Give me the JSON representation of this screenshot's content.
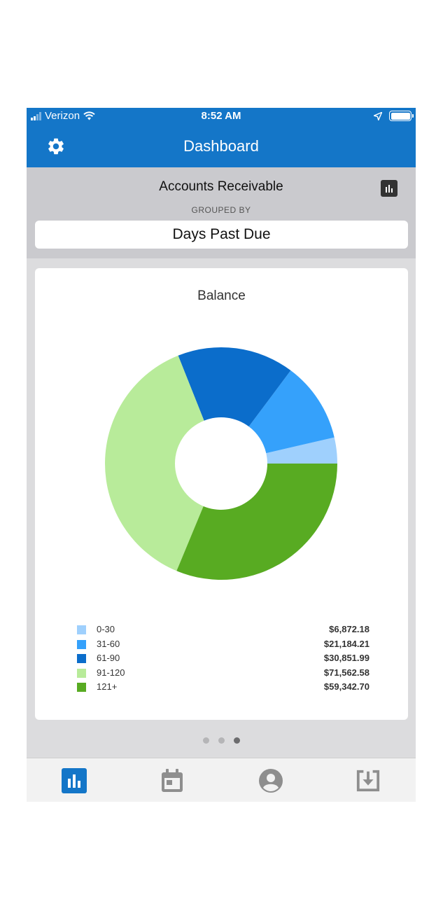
{
  "status_bar": {
    "carrier": "Verizon",
    "time": "8:52 AM"
  },
  "nav": {
    "title": "Dashboard"
  },
  "header": {
    "title": "Accounts Receivable",
    "grouped_by_label": "GROUPED BY",
    "grouped_by_value": "Days Past Due"
  },
  "chart_data": {
    "type": "pie",
    "title": "Balance",
    "categories": [
      "0-30",
      "31-60",
      "61-90",
      "91-120",
      "121+"
    ],
    "values": [
      6872.18,
      21184.21,
      30851.99,
      71562.58,
      59342.7
    ],
    "value_labels": [
      "$6,872.18",
      "$21,184.21",
      "$30,851.99",
      "$71,562.58",
      "$59,342.70"
    ],
    "colors": [
      "#9fd0fd",
      "#35a1fb",
      "#0b6dcb",
      "#b8eb9a",
      "#58ab22"
    ],
    "donut": true,
    "legend": "bottom"
  },
  "pagination": {
    "count": 3,
    "active": 2
  },
  "tabs": [
    {
      "icon": "bar-chart-icon",
      "active": true
    },
    {
      "icon": "calendar-icon",
      "active": false
    },
    {
      "icon": "person-icon",
      "active": false
    },
    {
      "icon": "download-icon",
      "active": false
    }
  ],
  "colors": {
    "brand": "#1476c8",
    "header_bg": "#cacace",
    "tab_active": "#1476c8",
    "tab_inactive": "#8e8e8e"
  }
}
